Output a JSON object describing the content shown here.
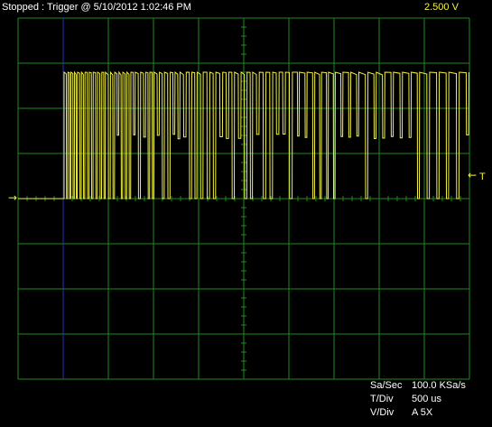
{
  "header": {
    "status": "Stopped : Trigger @ 5/10/2012 1:02:46 PM",
    "volts_per_div": "2.500  V"
  },
  "colors": {
    "background": "#000000",
    "grid": "#1e8a1e",
    "grid_frame": "#1e8a1e",
    "trace": "#f2f24a",
    "trigger_cursor": "#2030c8",
    "header_text": "#ffffff",
    "volts_text": "#f2f24a"
  },
  "markers": {
    "ground_symbol": "arrow-right-icon",
    "trigger_symbol": "arrow-left-icon",
    "trigger_label": "T"
  },
  "readouts": [
    {
      "label": "Sa/Sec",
      "value": "100.0 KSa/s"
    },
    {
      "label": "T/Div",
      "value": "500 us"
    },
    {
      "label": "V/Div",
      "value": "A 5X"
    }
  ]
}
